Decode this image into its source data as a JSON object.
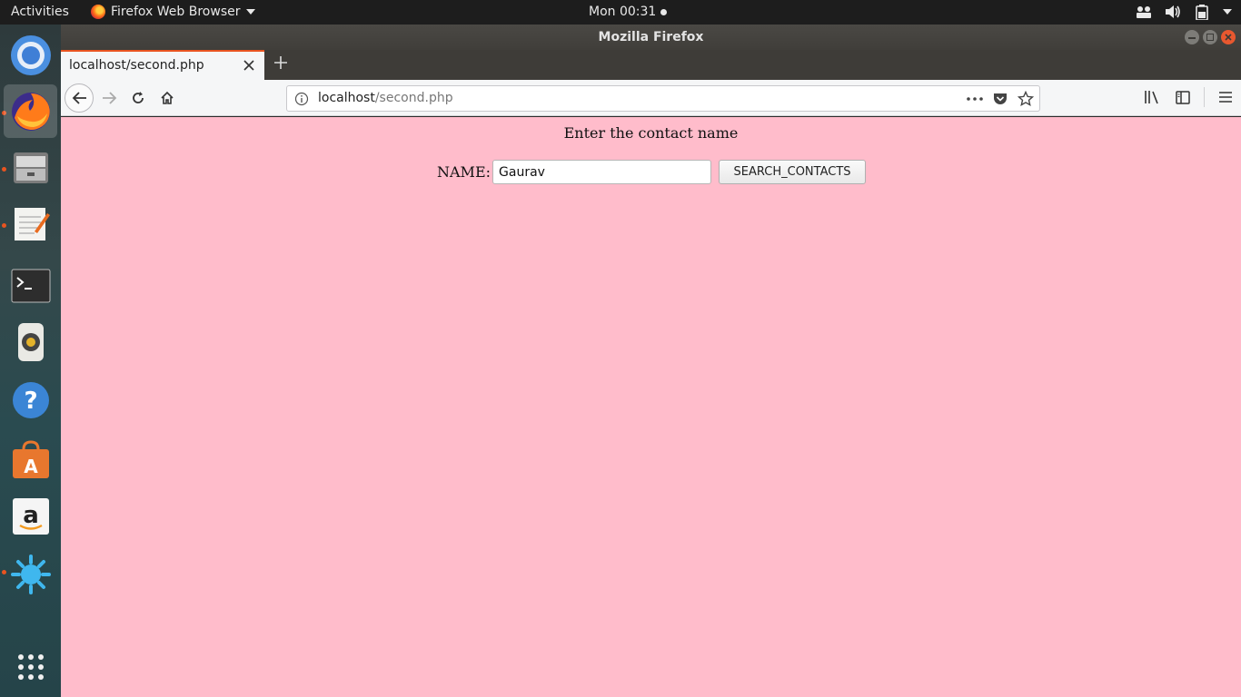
{
  "topbar": {
    "activities": "Activities",
    "app_menu": "Firefox Web Browser",
    "clock": "Mon 00:31"
  },
  "window": {
    "title": "Mozilla Firefox"
  },
  "tab": {
    "title": "localhost/second.php"
  },
  "urlbar": {
    "host": "localhost",
    "path": "/second.php"
  },
  "page": {
    "heading": "Enter the contact name",
    "name_label": "NAME:",
    "name_value": "Gaurav",
    "search_button": "SEARCH_CONTACTS",
    "background": "#ffbccb"
  },
  "dock": {
    "items": [
      "chrome-icon",
      "firefox-icon",
      "files-icon",
      "text-editor-icon",
      "terminal-icon",
      "rhythmbox-icon",
      "help-icon",
      "software-center-icon",
      "amazon-icon",
      "app-icon",
      "show-apps-icon"
    ]
  },
  "colors": {
    "accent": "#e95420"
  }
}
